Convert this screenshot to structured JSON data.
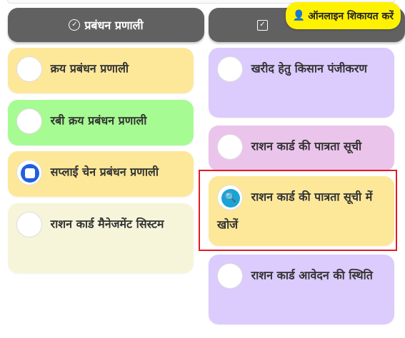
{
  "header": {
    "left_title": "प्रबंधन प्रणाली",
    "right_title": "",
    "complaint_label": "ऑनलाइन शिकायत करें"
  },
  "left_column": [
    {
      "label": "क्रय प्रबंधन प्रणाली",
      "icon": "wheat-field-icon"
    },
    {
      "label": "रबी क्रय प्रबंधन प्रणाली",
      "icon": "wheat-grain-icon"
    },
    {
      "label": "सप्लाई चेन प्रबंधन प्रणाली",
      "icon": "supply-chain-icon"
    },
    {
      "label": "राशन कार्ड मैनेजमेंट सिस्टम",
      "icon": "ration-card-icon"
    }
  ],
  "right_column": [
    {
      "label": "खरीद हेतु किसान पंजीकरण",
      "icon": "farmer-icon"
    },
    {
      "label": "राशन कार्ड की पात्रता सूची",
      "icon": "list-icon"
    },
    {
      "label": "राशन कार्ड की पात्रता सूची में खोजें",
      "icon": "search-icon"
    },
    {
      "label": "राशन कार्ड आवेदन की स्थिति",
      "icon": "list-icon"
    }
  ],
  "colors": {
    "header_bg": "#616161",
    "yellow_card": "#fde89a",
    "green_card": "#a6fb92",
    "cream_card": "#f6f5da",
    "lavender_card": "#dccbfd",
    "pink_card": "#ebc4eb",
    "complaint_bg": "#fff200",
    "highlight_border": "#e31b23"
  }
}
